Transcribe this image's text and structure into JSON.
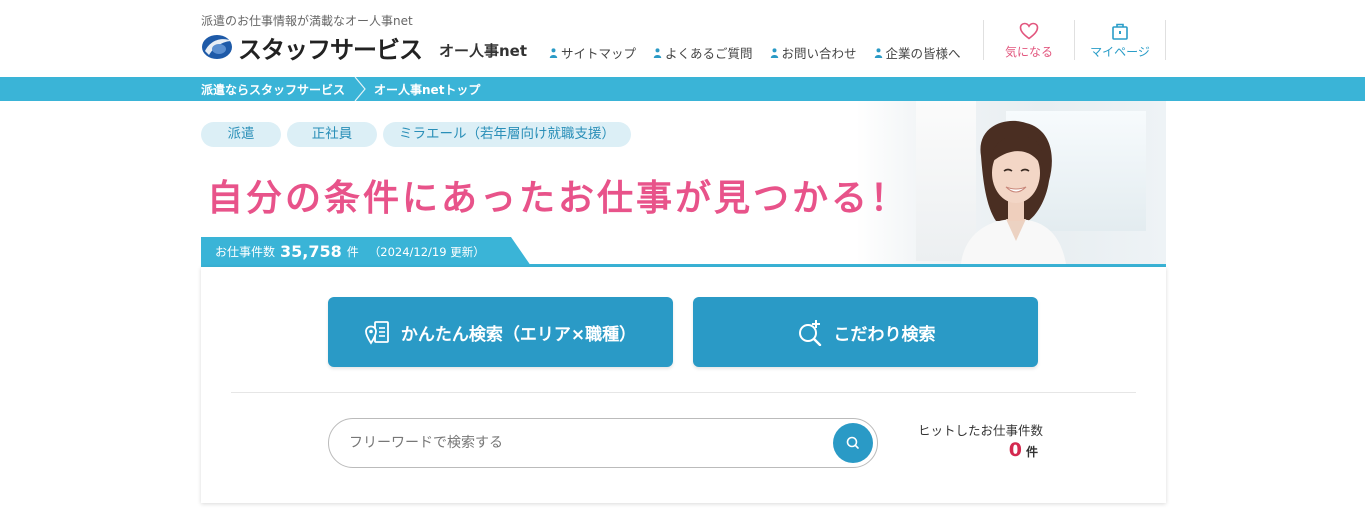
{
  "header": {
    "tagline": "派遣のお仕事情報が満載なオー人事net",
    "logo_text": "スタッフサービス",
    "brand_sub": "オー人事net",
    "nav": [
      {
        "label": "サイトマップ"
      },
      {
        "label": "よくあるご質問"
      },
      {
        "label": "お問い合わせ"
      },
      {
        "label": "企業の皆様へ"
      }
    ],
    "favorites_label": "気になる",
    "mypage_label": "マイページ"
  },
  "breadcrumb": {
    "items": [
      {
        "label": "派遣ならスタッフサービス"
      },
      {
        "label": "オー人事netトップ"
      }
    ]
  },
  "hero": {
    "tabs": [
      {
        "label": "派遣"
      },
      {
        "label": "正社員"
      },
      {
        "label": "ミラエール（若年層向け就職支援）"
      }
    ],
    "title": "自分の条件にあったお仕事が見つかる！",
    "count_label": "お仕事件数",
    "count_value": "35,758",
    "count_unit": "件",
    "updated": "（2024/12/19 更新）"
  },
  "search": {
    "easy_search_label": "かんたん検索（エリア×職種）",
    "detail_search_label": "こだわり検索",
    "freeword_placeholder": "フリーワードで検索する",
    "freeword_value": "",
    "hits_label": "ヒットしたお仕事件数",
    "hits_value": "0",
    "hits_unit": "件"
  },
  "colors": {
    "accent_blue": "#3ab4d7",
    "button_blue": "#2a9ac6",
    "title_pink": "#e8538a",
    "hit_red": "#d4294f"
  },
  "icons": {
    "favorites": "heart-icon",
    "mypage": "bag-icon",
    "nav": "person-icon",
    "easy_search": "map-pin-list-icon",
    "detail_search": "search-plus-icon",
    "submit": "search-icon"
  }
}
